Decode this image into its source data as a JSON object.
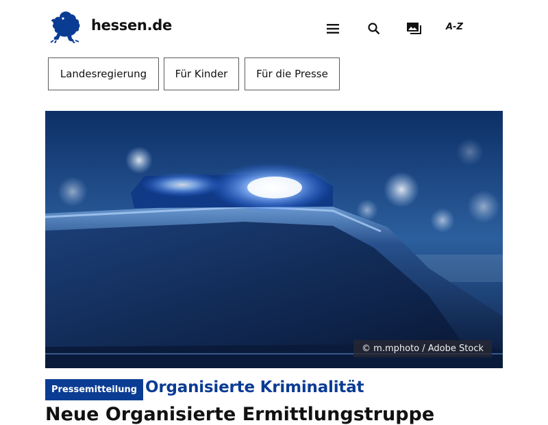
{
  "header": {
    "site_name": "hessen.de",
    "logo_icon": "hessen-lion-logo-icon",
    "menu_icon": "hamburger-menu-icon",
    "search_icon": "search-icon",
    "media_icon": "image-gallery-icon",
    "az_label": "A-Z"
  },
  "nav_pills": [
    {
      "label": "Landesregierung"
    },
    {
      "label": "Für Kinder"
    },
    {
      "label": "Für die Presse"
    }
  ],
  "hero": {
    "image_subject": "police car blue light at night",
    "credit": "© m.mphoto / Adobe Stock"
  },
  "article": {
    "badge": "Pressemitteilung",
    "topic": "Organisierte Kriminalität",
    "headline": "Neue Organisierte Ermittlungstruppe"
  },
  "colors": {
    "brand_blue": "#0b3c94",
    "text": "#111111",
    "border": "#5a5a5a"
  }
}
